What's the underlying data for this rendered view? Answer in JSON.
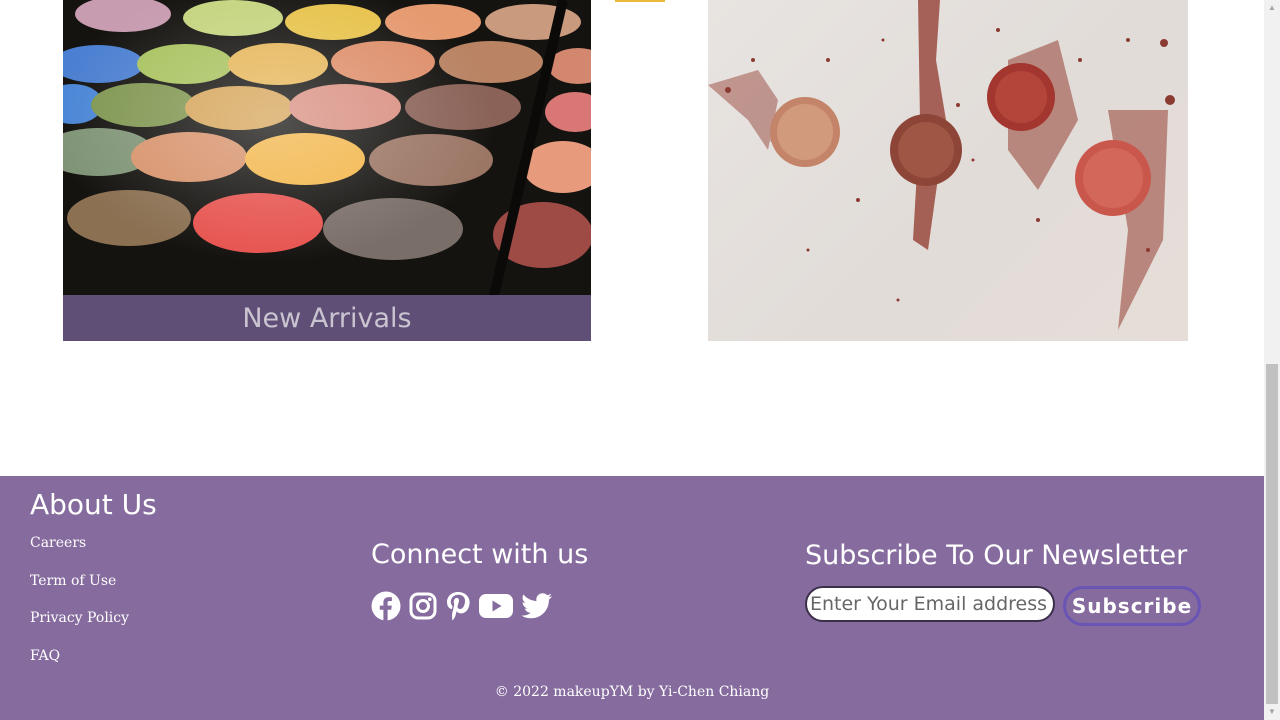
{
  "cards": {
    "palette": {
      "caption": "New Arrivals",
      "image": "eyeshadow-palette-photo"
    },
    "powder": {
      "image": "crushed-powder-photo"
    }
  },
  "footer": {
    "about": {
      "heading": "About Us",
      "links": [
        "Careers",
        "Term of Use",
        "Privacy Policy",
        "FAQ"
      ]
    },
    "connect": {
      "heading": "Connect with us",
      "icons": [
        "facebook-icon",
        "instagram-icon",
        "pinterest-icon",
        "youtube-icon",
        "twitter-icon"
      ]
    },
    "newsletter": {
      "heading": "Subscribe To Our Newsletter",
      "email_placeholder": "Enter Your Email address",
      "button_label": "Subscribe"
    },
    "copyright": "© 2022 makeupYM by Yi-Chen Chiang"
  },
  "colors": {
    "footer_bg": "#866b9e",
    "caption_bg": "#5f4f77",
    "button_border": "#6a55b5"
  }
}
